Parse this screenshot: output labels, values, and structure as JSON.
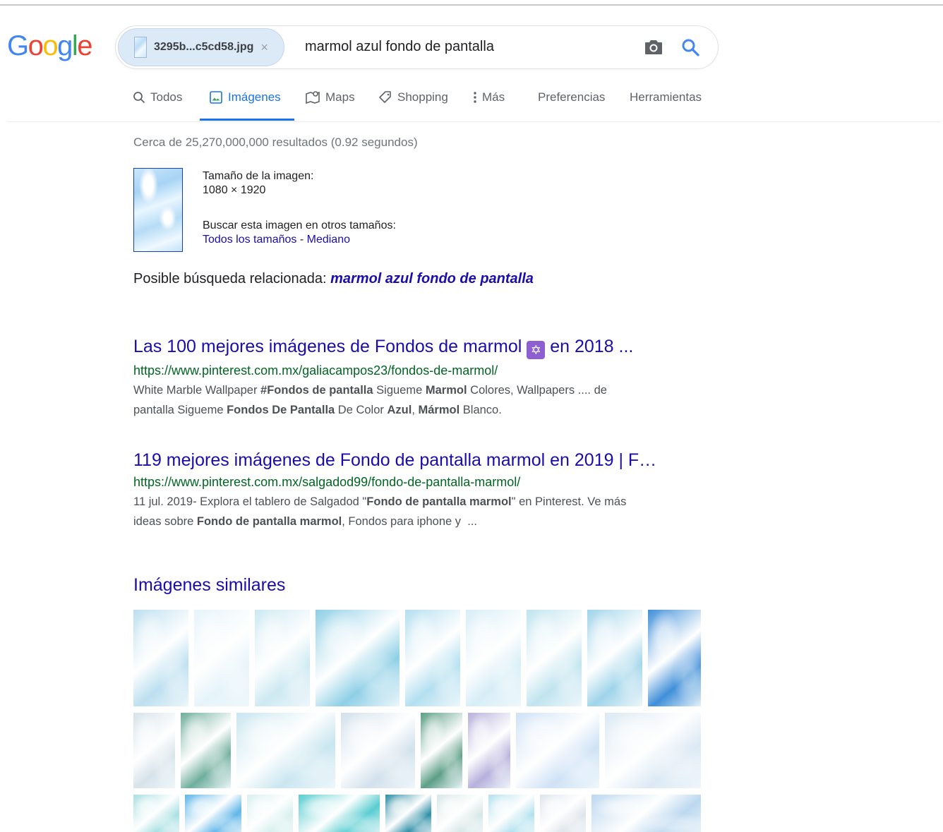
{
  "logo": {
    "text": "Google",
    "letters": [
      {
        "ch": "G",
        "color": "#4285F4"
      },
      {
        "ch": "o",
        "color": "#EA4335"
      },
      {
        "ch": "o",
        "color": "#FBBC05"
      },
      {
        "ch": "g",
        "color": "#4285F4"
      },
      {
        "ch": "l",
        "color": "#34A853"
      },
      {
        "ch": "e",
        "color": "#EA4335"
      }
    ]
  },
  "search": {
    "image_chip_name": "3295b...c5cd58.jpg",
    "chip_close": "×",
    "query": "marmol azul fondo de pantalla"
  },
  "tabs": [
    {
      "label": "Todos",
      "icon": "search-icon"
    },
    {
      "label": "Imágenes",
      "icon": "image-icon",
      "active": true
    },
    {
      "label": "Maps",
      "icon": "map-pin-icon"
    },
    {
      "label": "Shopping",
      "icon": "tag-icon"
    },
    {
      "label": "Más",
      "icon": "more-vertical-icon"
    },
    {
      "label": "Preferencias"
    },
    {
      "label": "Herramientas"
    }
  ],
  "result_stats": "Cerca de 25,270,000,000 resultados (0.92 segundos)",
  "image_info": {
    "size_label": "Tamaño de la imagen:",
    "size_value": "1080 × 1920",
    "other_sizes_label": "Buscar esta imagen en otros tamaños:",
    "all_sizes_link": "Todos los tamaños",
    "separator": " - ",
    "medium_link": "Mediano"
  },
  "related": {
    "label": "Posible búsqueda relacionada: ",
    "query": "marmol azul fondo de pantalla"
  },
  "results": [
    {
      "title_before": "Las 100 mejores imágenes de Fondos de marmol ",
      "title_emoji": "✡",
      "title_after": " en 2018 ...",
      "url": "https://www.pinterest.com.mx/galiacampos23/fondos-de-marmol/",
      "snippet_line1": [
        {
          "t": "White Marble Wallpaper "
        },
        {
          "t": "#Fondos de pantalla",
          "b": true
        },
        {
          "t": " Sigueme "
        },
        {
          "t": "Marmol",
          "b": true
        },
        {
          "t": " Colores, Wallpapers .... de"
        }
      ],
      "snippet_line2": [
        {
          "t": "pantalla Sigueme "
        },
        {
          "t": "Fondos De Pantalla",
          "b": true
        },
        {
          "t": " De Color "
        },
        {
          "t": "Azul",
          "b": true
        },
        {
          "t": ", "
        },
        {
          "t": "Mármol",
          "b": true
        },
        {
          "t": " Blanco."
        }
      ]
    },
    {
      "title_before": "119 mejores imágenes de Fondo de pantalla marmol en 2019 | F…",
      "url": "https://www.pinterest.com.mx/salgadod99/fondo-de-pantalla-marmol/",
      "snippet_line1": [
        {
          "t": "11 jul. 2019- Explora el tablero de Salgadod \""
        },
        {
          "t": "Fondo de pantalla marmol",
          "b": true
        },
        {
          "t": "\" en Pinterest. Ve más"
        }
      ],
      "snippet_line2": [
        {
          "t": "ideas sobre "
        },
        {
          "t": "Fondo de pantalla marmol",
          "b": true
        },
        {
          "t": ", Fondos para iphone y  ..."
        }
      ]
    }
  ],
  "similar_title": "Imágenes similares",
  "similar_colors": [
    [
      "#bcdff0",
      "#e6f4fa",
      "#cde9f2",
      "#8ecfe6",
      "#b3dff0",
      "#d7eef7",
      "#c0e4ef",
      "#9fd4ea",
      "#3f8fd8"
    ],
    [
      "#d6e3ea",
      "#6fae9c",
      "#c9e6f0",
      "#d2e1ec",
      "#5c9e86",
      "#b7b0dc",
      "#cfe2f6",
      "#dce9f4"
    ],
    [
      "#a9e0e3",
      "#5fb6e8",
      "#d7f0ee",
      "#59cdd0",
      "#2f8fa6",
      "#d7e8e6",
      "#b4e2ef",
      "#dfe5ec",
      "#bcd8ef"
    ]
  ]
}
